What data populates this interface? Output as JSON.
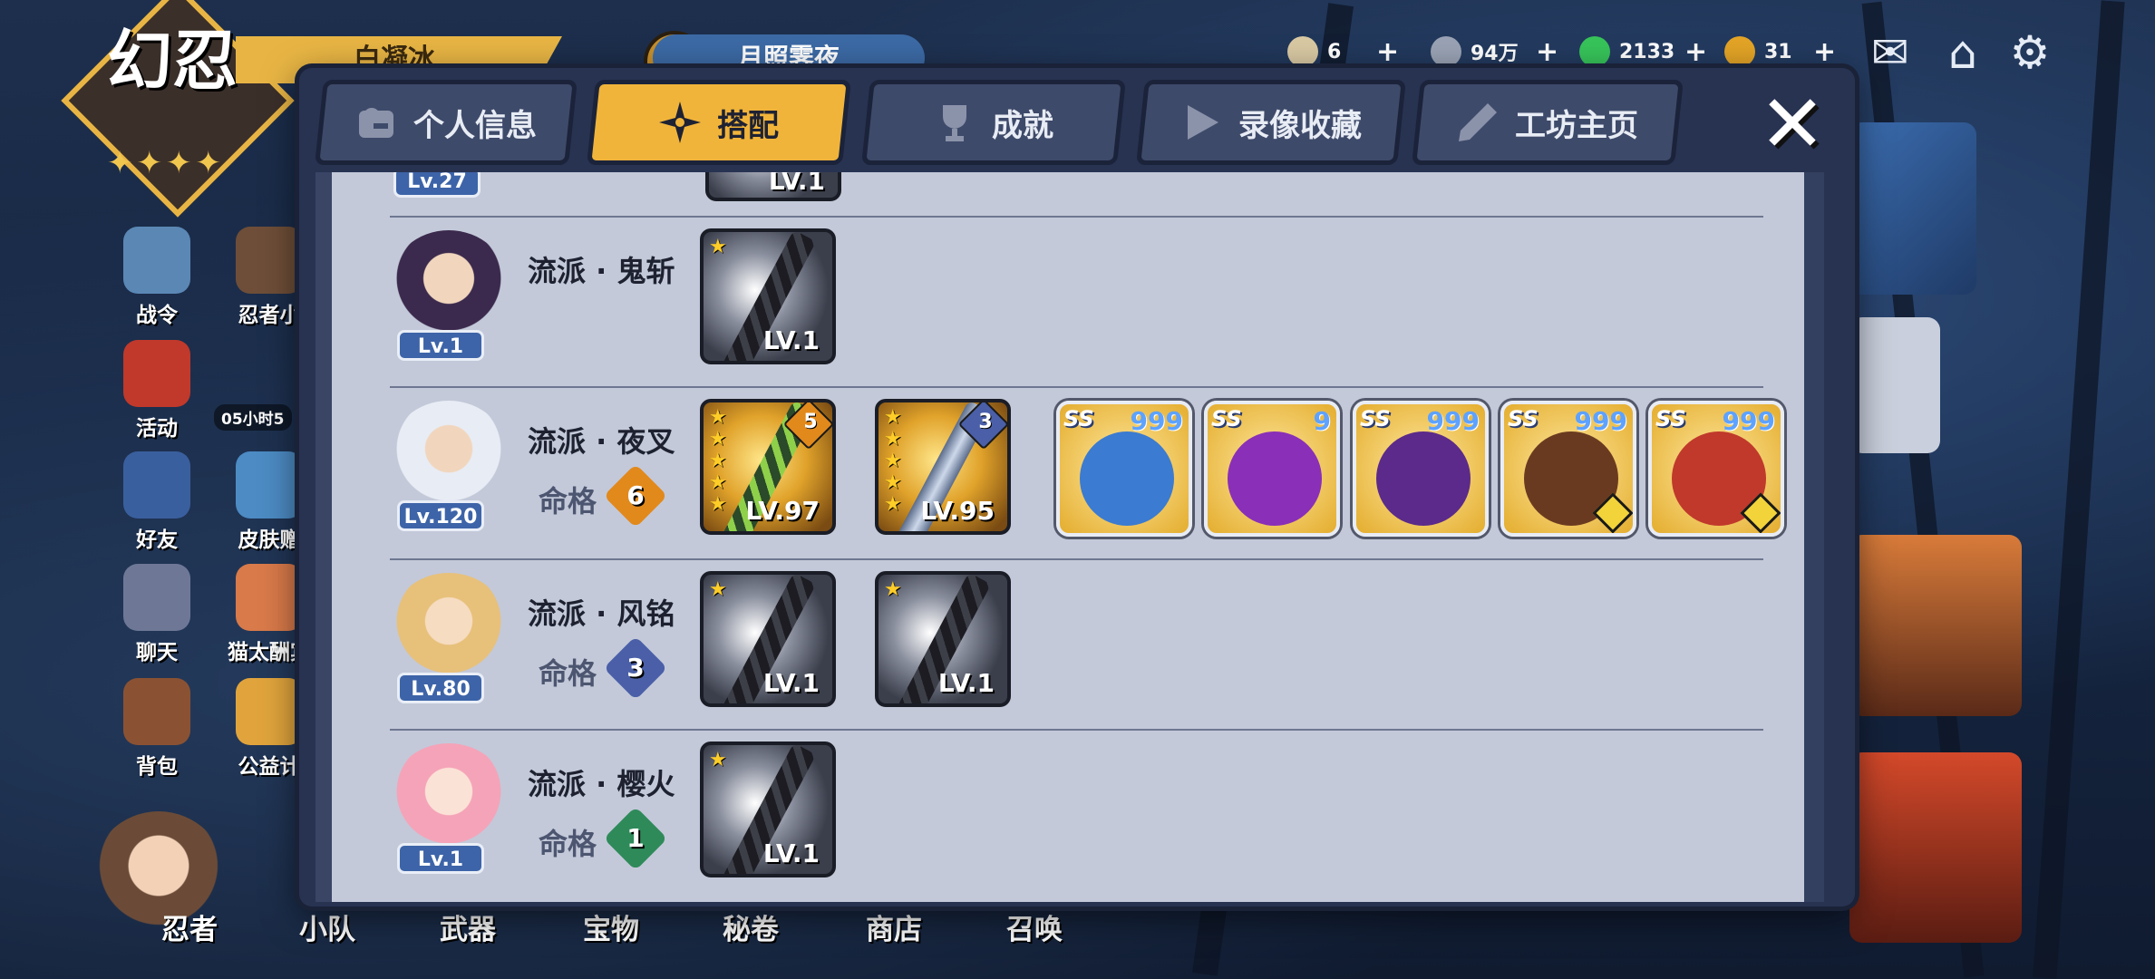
{
  "hud": {
    "logo_text": "幻忍",
    "logo_stars": "✦✦✦✦",
    "player_name": "白凝冰",
    "event_title": "月照霁夜",
    "resources": [
      {
        "icon": "rice-ball-icon",
        "value": "6",
        "color": "#d9c9a3"
      },
      {
        "icon": "coin-icon",
        "value": "94万",
        "color": "#9aa3b5"
      },
      {
        "icon": "green-pin-icon",
        "value": "2133",
        "color": "#37c45a"
      },
      {
        "icon": "gold-pin-icon",
        "value": "31",
        "color": "#e3a426"
      }
    ],
    "plus": "+"
  },
  "left_menu": [
    {
      "label": "战令",
      "icon": "battle-pass-icon"
    },
    {
      "label": "忍者小",
      "icon": "ninja-house-icon"
    },
    {
      "label": "活动",
      "icon": "torii-gate-icon"
    },
    {
      "label": "好友",
      "icon": "friends-icon"
    },
    {
      "label": "皮肤赠",
      "icon": "skin-gift-icon"
    },
    {
      "label": "聊天",
      "icon": "chat-icon"
    },
    {
      "label": "猫太酬宾",
      "icon": "cat-shop-icon"
    },
    {
      "label": "背包",
      "icon": "backpack-icon"
    },
    {
      "label": "公益计",
      "icon": "charity-icon"
    }
  ],
  "timer": "05小时5",
  "bottom_nav": [
    "忍者",
    "小队",
    "武器",
    "宝物",
    "秘卷",
    "商店",
    "召唤"
  ],
  "tabs": [
    {
      "label": "个人信息",
      "icon": "profile-card-icon",
      "active": false
    },
    {
      "label": "搭配",
      "icon": "shuriken-icon",
      "active": true
    },
    {
      "label": "成就",
      "icon": "trophy-icon",
      "active": false
    },
    {
      "label": "录像收藏",
      "icon": "play-icon",
      "active": false
    },
    {
      "label": "工坊主页",
      "icon": "pencil-icon",
      "active": false
    }
  ],
  "close_symbol": "✕",
  "partial_row": {
    "lv": "Lv.27",
    "weapon_lv": "LV.1"
  },
  "rows": [
    {
      "name": "流派 · 鬼斩",
      "lv": "Lv.1",
      "fate_label": "",
      "fate": "",
      "weapons": [
        {
          "lv": "LV.1",
          "stars": 1,
          "gold": false,
          "badge": ""
        }
      ],
      "scrolls": []
    },
    {
      "name": "流派 · 夜叉",
      "lv": "Lv.120",
      "fate_label": "命格",
      "fate": "6",
      "weapons": [
        {
          "lv": "LV.97",
          "stars": 5,
          "gold": true,
          "badge": "5"
        },
        {
          "lv": "LV.95",
          "stars": 5,
          "gold": true,
          "badge": "3"
        }
      ],
      "scrolls": [
        {
          "rank": "SS",
          "marks": "999",
          "art_color": "#3b7bd1",
          "pin": false
        },
        {
          "rank": "SS",
          "marks": "9",
          "art_color": "#8a2fb8",
          "pin": false
        },
        {
          "rank": "SS",
          "marks": "999",
          "art_color": "#5b2a8a",
          "pin": false
        },
        {
          "rank": "SS",
          "marks": "999",
          "art_color": "#6a3a20",
          "pin": true
        },
        {
          "rank": "SS",
          "marks": "999",
          "art_color": "#c0392b",
          "pin": true
        }
      ]
    },
    {
      "name": "流派 · 风铭",
      "lv": "Lv.80",
      "fate_label": "命格",
      "fate": "3",
      "weapons": [
        {
          "lv": "LV.1",
          "stars": 1,
          "gold": false,
          "badge": ""
        },
        {
          "lv": "LV.1",
          "stars": 1,
          "gold": false,
          "badge": ""
        }
      ],
      "scrolls": []
    },
    {
      "name": "流派 · 樱火",
      "lv": "Lv.1",
      "fate_label": "命格",
      "fate": "1",
      "weapons": [
        {
          "lv": "LV.1",
          "stars": 1,
          "gold": false,
          "badge": ""
        }
      ],
      "scrolls": []
    }
  ],
  "colors": {
    "tab_active": "#f1b43a",
    "panel": "#c3c9d9",
    "level_badge": "#3d64a8",
    "fate_badge_colors": [
      "#e2891c",
      "#4a5fa8",
      "#2f8a5a"
    ]
  }
}
